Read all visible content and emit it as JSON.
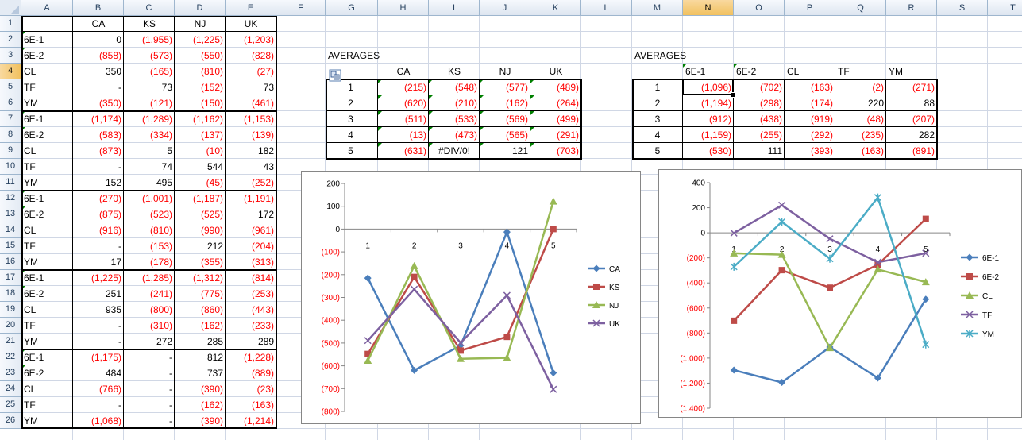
{
  "columns": [
    "A",
    "B",
    "C",
    "D",
    "E",
    "F",
    "G",
    "H",
    "I",
    "J",
    "K",
    "L",
    "M",
    "N",
    "O",
    "P",
    "Q",
    "R",
    "S",
    "T"
  ],
  "selected_column": "N",
  "selected_row": 4,
  "rows": [
    1,
    2,
    3,
    4,
    5,
    6,
    7,
    8,
    9,
    10,
    11,
    12,
    13,
    14,
    15,
    16,
    17,
    18,
    19,
    20,
    21,
    22,
    23,
    24,
    25,
    26
  ],
  "main_table": {
    "headers": [
      "CA",
      "KS",
      "NJ",
      "UK"
    ],
    "rows": [
      {
        "label": "6E-1",
        "values": [
          "0",
          "(1,955)",
          "(1,225)",
          "(1,203)"
        ]
      },
      {
        "label": "6E-2",
        "values": [
          "(858)",
          "(573)",
          "(550)",
          "(828)"
        ]
      },
      {
        "label": "CL",
        "values": [
          "350",
          "(165)",
          "(810)",
          "(27)"
        ]
      },
      {
        "label": "TF",
        "values": [
          "-",
          "73",
          "(152)",
          "73"
        ]
      },
      {
        "label": "YM",
        "values": [
          "(350)",
          "(121)",
          "(150)",
          "(461)"
        ]
      },
      {
        "label": "6E-1",
        "values": [
          "(1,174)",
          "(1,289)",
          "(1,162)",
          "(1,153)"
        ]
      },
      {
        "label": "6E-2",
        "values": [
          "(583)",
          "(334)",
          "(137)",
          "(139)"
        ]
      },
      {
        "label": "CL",
        "values": [
          "(873)",
          "5",
          "(10)",
          "182"
        ]
      },
      {
        "label": "TF",
        "values": [
          "-",
          "74",
          "544",
          "43"
        ]
      },
      {
        "label": "YM",
        "values": [
          "152",
          "495",
          "(45)",
          "(252)"
        ]
      },
      {
        "label": "6E-1",
        "values": [
          "(270)",
          "(1,001)",
          "(1,187)",
          "(1,191)"
        ]
      },
      {
        "label": "6E-2",
        "values": [
          "(875)",
          "(523)",
          "(525)",
          "172"
        ]
      },
      {
        "label": "CL",
        "values": [
          "(916)",
          "(810)",
          "(990)",
          "(961)"
        ]
      },
      {
        "label": "TF",
        "values": [
          "-",
          "(153)",
          "212",
          "(204)"
        ]
      },
      {
        "label": "YM",
        "values": [
          "17",
          "(178)",
          "(355)",
          "(313)"
        ]
      },
      {
        "label": "6E-1",
        "values": [
          "(1,225)",
          "(1,285)",
          "(1,312)",
          "(814)"
        ]
      },
      {
        "label": "6E-2",
        "values": [
          "251",
          "(241)",
          "(775)",
          "(253)"
        ]
      },
      {
        "label": "CL",
        "values": [
          "935",
          "(800)",
          "(860)",
          "(443)"
        ]
      },
      {
        "label": "TF",
        "values": [
          "-",
          "(310)",
          "(162)",
          "(233)"
        ]
      },
      {
        "label": "YM",
        "values": [
          "-",
          "272",
          "285",
          "289"
        ]
      },
      {
        "label": "6E-1",
        "values": [
          "(1,175)",
          "-",
          "812",
          "(1,228)"
        ]
      },
      {
        "label": "6E-2",
        "values": [
          "484",
          "-",
          "737",
          "(889)"
        ]
      },
      {
        "label": "CL",
        "values": [
          "(766)",
          "-",
          "(390)",
          "(23)"
        ]
      },
      {
        "label": "TF",
        "values": [
          "-",
          "-",
          "(162)",
          "(163)"
        ]
      },
      {
        "label": "YM",
        "values": [
          "(1,068)",
          "-",
          "(390)",
          "(1,214)"
        ]
      }
    ]
  },
  "averages_state": {
    "title": "AVERAGES",
    "headers": [
      "CA",
      "KS",
      "NJ",
      "UK"
    ],
    "rows": [
      {
        "label": "1",
        "values": [
          "(215)",
          "(548)",
          "(577)",
          "(489)"
        ]
      },
      {
        "label": "2",
        "values": [
          "(620)",
          "(210)",
          "(162)",
          "(264)"
        ]
      },
      {
        "label": "3",
        "values": [
          "(511)",
          "(533)",
          "(569)",
          "(499)"
        ]
      },
      {
        "label": "4",
        "values": [
          "(13)",
          "(473)",
          "(565)",
          "(291)"
        ]
      },
      {
        "label": "5",
        "values": [
          "(631)",
          "#DIV/0!",
          "121",
          "(703)"
        ]
      }
    ]
  },
  "averages_product": {
    "title": "AVERAGES",
    "headers": [
      "6E-1",
      "6E-2",
      "CL",
      "TF",
      "YM"
    ],
    "rows": [
      {
        "label": "1",
        "values": [
          "(1,096)",
          "(702)",
          "(163)",
          "(2)",
          "(271)"
        ]
      },
      {
        "label": "2",
        "values": [
          "(1,194)",
          "(298)",
          "(174)",
          "220",
          "88"
        ]
      },
      {
        "label": "3",
        "values": [
          "(912)",
          "(438)",
          "(919)",
          "(48)",
          "(207)"
        ]
      },
      {
        "label": "4",
        "values": [
          "(1,159)",
          "(255)",
          "(292)",
          "(235)",
          "282"
        ]
      },
      {
        "label": "5",
        "values": [
          "(530)",
          "111",
          "(393)",
          "(163)",
          "(891)"
        ]
      }
    ]
  },
  "chart_data": [
    {
      "type": "line",
      "categories": [
        "1",
        "2",
        "3",
        "4",
        "5"
      ],
      "ylim": [
        -800,
        200
      ],
      "yticks": [
        "200",
        "100",
        "0",
        "(100)",
        "(200)",
        "(300)",
        "(400)",
        "(500)",
        "(600)",
        "(700)",
        "(800)"
      ],
      "grid": false,
      "legend": "right",
      "series": [
        {
          "name": "CA",
          "color": "#4a7ebb",
          "marker": "diamond",
          "values": [
            -215,
            -620,
            -511,
            -13,
            -631
          ]
        },
        {
          "name": "KS",
          "color": "#be4b48",
          "marker": "square",
          "values": [
            -548,
            -210,
            -533,
            -473,
            0
          ]
        },
        {
          "name": "NJ",
          "color": "#98b954",
          "marker": "triangle",
          "values": [
            -577,
            -162,
            -569,
            -565,
            121
          ]
        },
        {
          "name": "UK",
          "color": "#7d60a0",
          "marker": "x",
          "values": [
            -489,
            -264,
            -499,
            -291,
            -703
          ]
        }
      ]
    },
    {
      "type": "line",
      "categories": [
        "1",
        "2",
        "3",
        "4",
        "5"
      ],
      "ylim": [
        -1400,
        400
      ],
      "yticks": [
        "400",
        "200",
        "0",
        "(200)",
        "(400)",
        "(600)",
        "(800)",
        "(1,000)",
        "(1,200)",
        "(1,400)"
      ],
      "grid": false,
      "legend": "right",
      "series": [
        {
          "name": "6E-1",
          "color": "#4a7ebb",
          "marker": "diamond",
          "values": [
            -1096,
            -1194,
            -912,
            -1159,
            -530
          ]
        },
        {
          "name": "6E-2",
          "color": "#be4b48",
          "marker": "square",
          "values": [
            -702,
            -298,
            -438,
            -255,
            111
          ]
        },
        {
          "name": "CL",
          "color": "#98b954",
          "marker": "triangle",
          "values": [
            -163,
            -174,
            -919,
            -292,
            -393
          ]
        },
        {
          "name": "TF",
          "color": "#7d60a0",
          "marker": "x",
          "values": [
            -2,
            220,
            -48,
            -235,
            -163
          ]
        },
        {
          "name": "YM",
          "color": "#4bacc6",
          "marker": "star",
          "values": [
            -271,
            88,
            -207,
            282,
            -891
          ]
        }
      ]
    }
  ]
}
